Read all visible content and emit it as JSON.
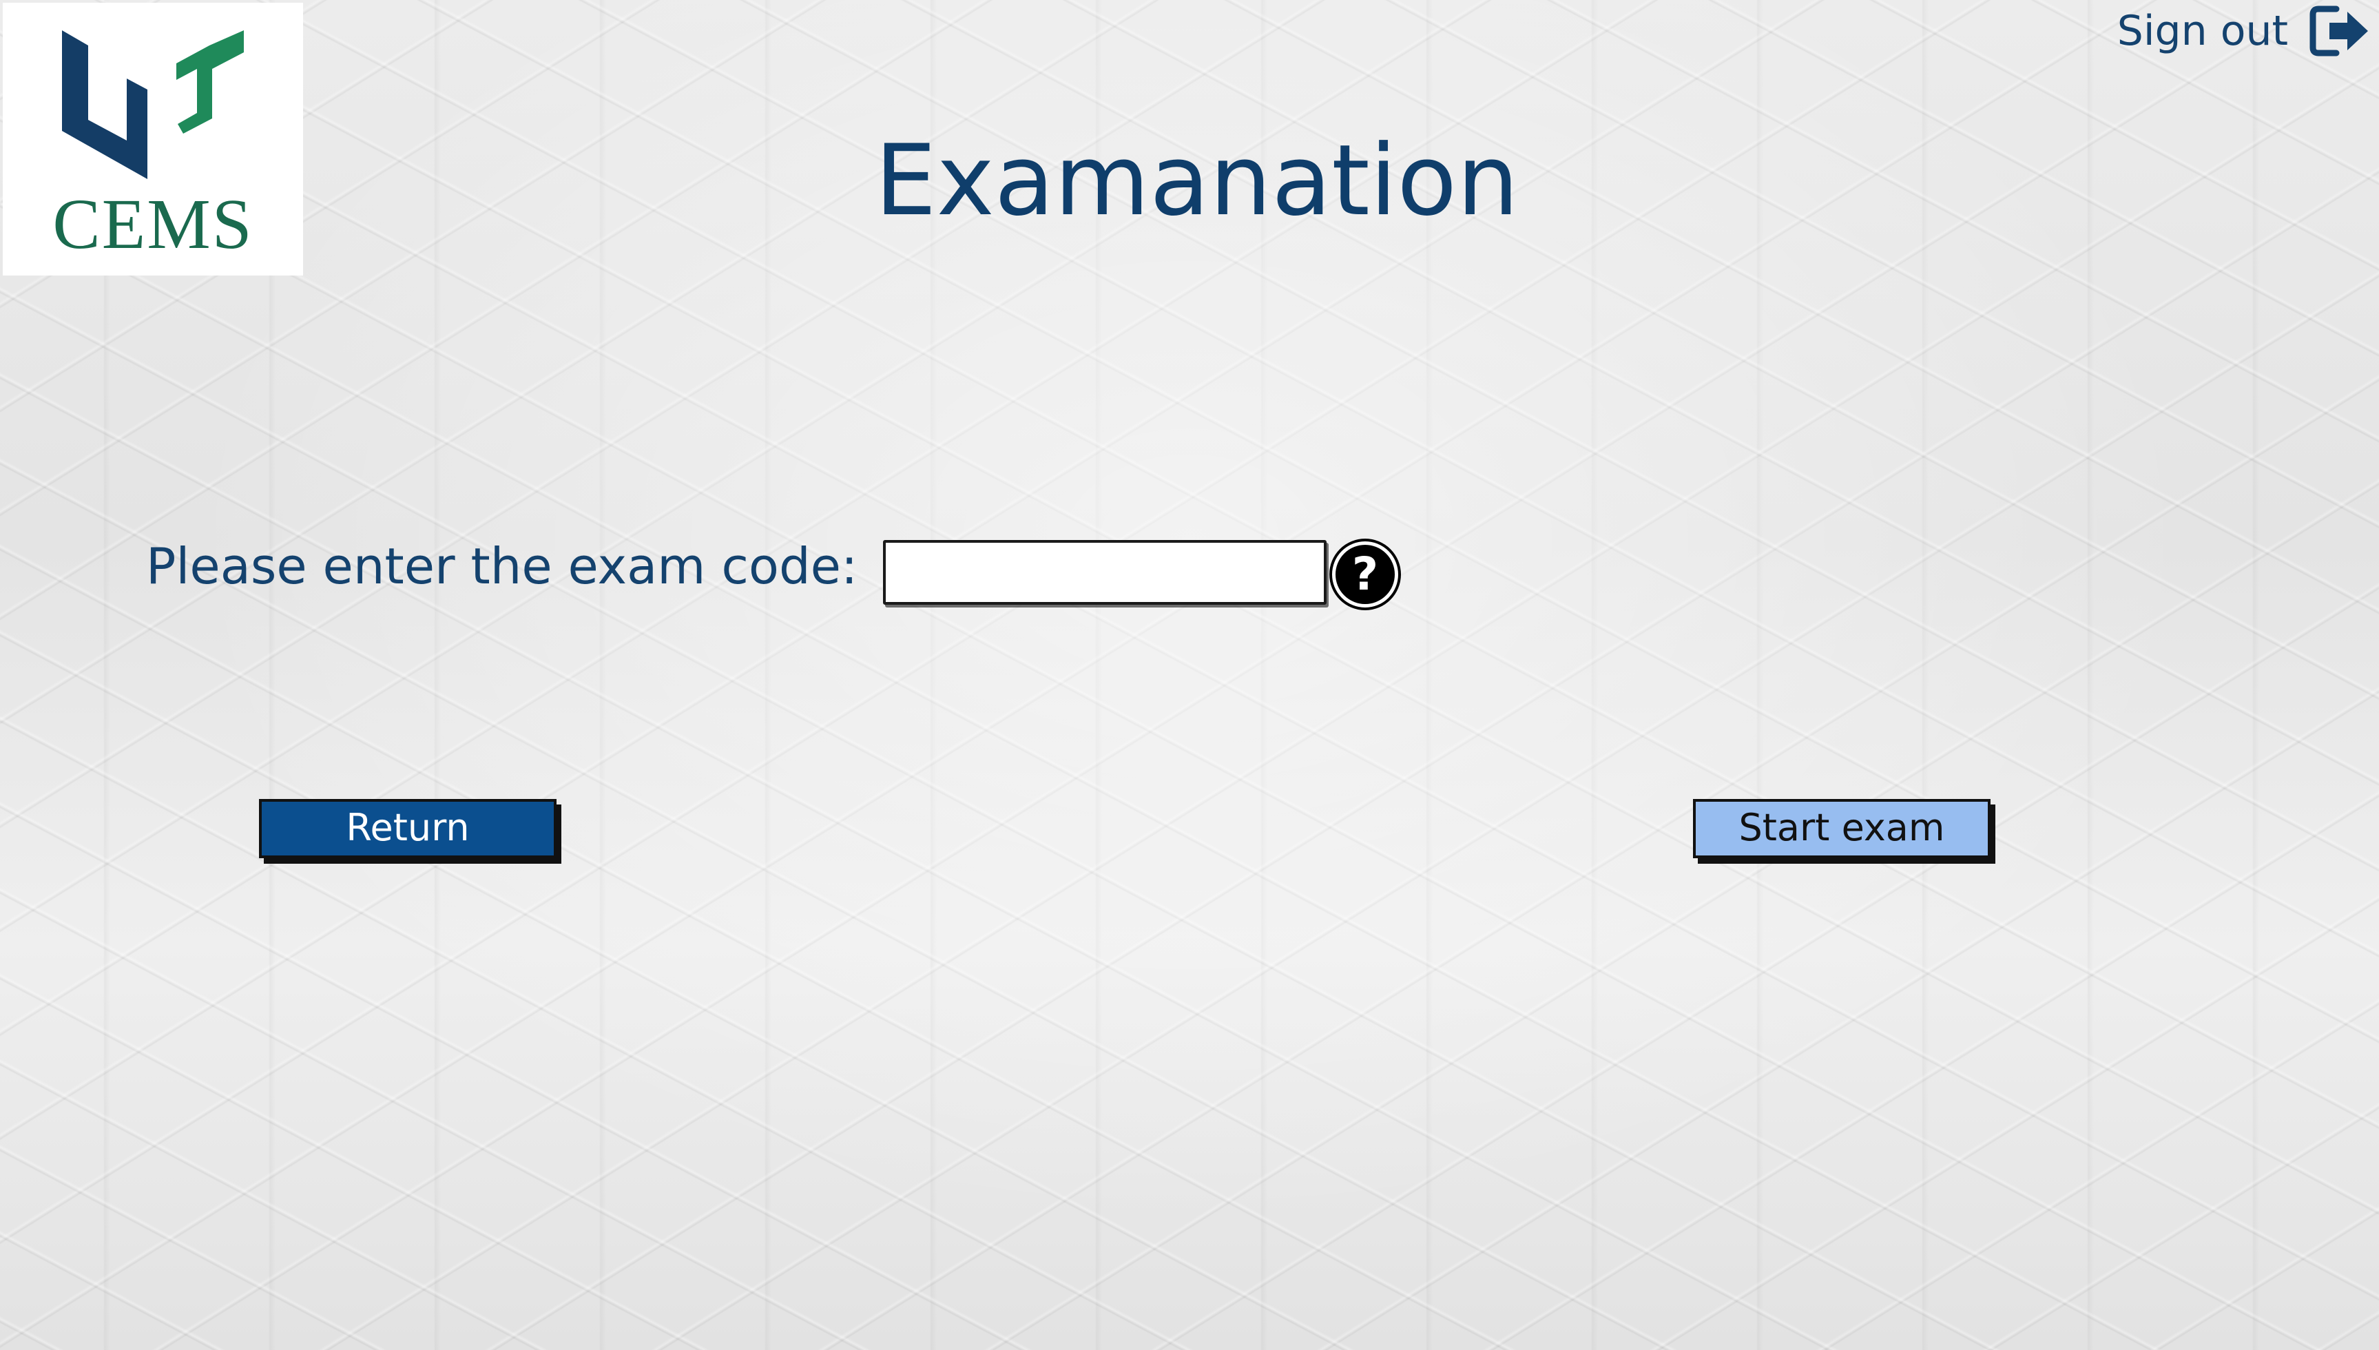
{
  "logo": {
    "text": "CEMS",
    "icon": "cems-logo-mark",
    "colors": {
      "navy": "#143d66",
      "green": "#1f8a5a",
      "text_green": "#1a6a4e"
    }
  },
  "header": {
    "signout_label": "Sign out",
    "signout_icon": "sign-out-icon"
  },
  "main": {
    "title": "Examanation",
    "code_prompt": "Please enter the exam code:",
    "code_input_value": "",
    "help_icon": "question-mark-icon",
    "help_glyph": "?"
  },
  "actions": {
    "return_label": "Return",
    "start_label": "Start exam"
  },
  "colors": {
    "accent_dark": "#0b4f8f",
    "accent_light": "#97bdf0",
    "text_navy": "#14426e"
  }
}
